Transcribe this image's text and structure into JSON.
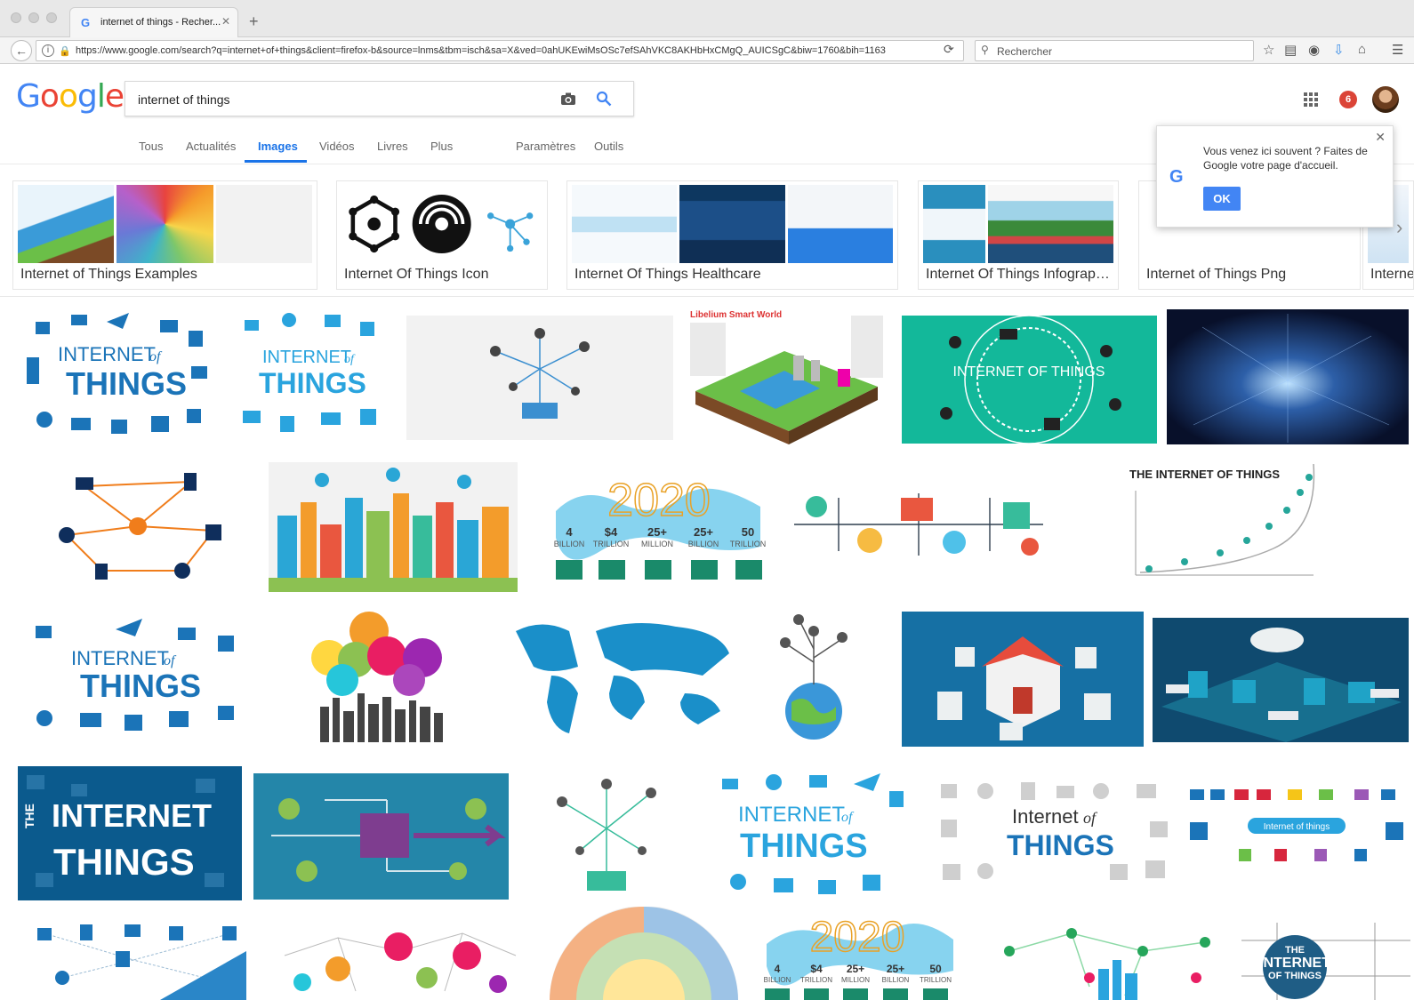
{
  "browser": {
    "tab_title": "internet of things - Recher...",
    "tab_close": "✕",
    "new_tab": "+",
    "url": "https://www.google.com/search?q=internet+of+things&client=firefox-b&source=lnms&tbm=isch&sa=X&ved=0ahUKEwiMsOSc7efSAhVKC8AKHbHxCMgQ_AUICSgC&biw=1760&bih=1163",
    "search_placeholder": "Rechercher"
  },
  "google": {
    "query": "internet of things",
    "notification_count": "6",
    "tabs": [
      {
        "label": "Tous"
      },
      {
        "label": "Actualités"
      },
      {
        "label": "Images"
      },
      {
        "label": "Vidéos"
      },
      {
        "label": "Livres"
      },
      {
        "label": "Plus"
      },
      {
        "label": "Paramètres"
      },
      {
        "label": "Outils"
      }
    ]
  },
  "popup": {
    "text": "Vous venez ici souvent ? Faites de Google votre page d'accueil.",
    "ok_label": "OK"
  },
  "related": [
    {
      "label": "Internet of Things Examples"
    },
    {
      "label": "Internet Of Things Icon"
    },
    {
      "label": "Internet Of Things Healthcare"
    },
    {
      "label": "Internet Of Things Infograp…"
    },
    {
      "label": "Internet of Things Png"
    },
    {
      "label": "Interne"
    }
  ],
  "images": {
    "libelium_caption": "Libelium Smart World",
    "iot_title_a": "INTERNET",
    "iot_title_of": "of",
    "iot_title_b": "THINGS",
    "iot_the": "THE",
    "iot_teal": "INTERNET OF THINGS",
    "year_2020": "2020",
    "stats": [
      "4",
      "$4",
      "25+",
      "25+",
      "50"
    ],
    "stats_units": [
      "BILLION",
      "TRILLION",
      "MILLION",
      "BILLION",
      "TRILLION"
    ],
    "iot_chart_title": "THE INTERNET OF THINGS",
    "iot_script_a": "Internet",
    "iot_script_of": "of",
    "iot_script_b": "THINGS",
    "iot_small": "Internet of things",
    "iot_badge_the": "THE",
    "iot_badge_a": "INTERNET",
    "iot_badge_b": "OF THINGS"
  },
  "colors": {
    "accent": "#1a73e8",
    "iot_blue": "#1b74b8",
    "teal": "#13b89a",
    "dark_navy": "#0e1a3a"
  }
}
